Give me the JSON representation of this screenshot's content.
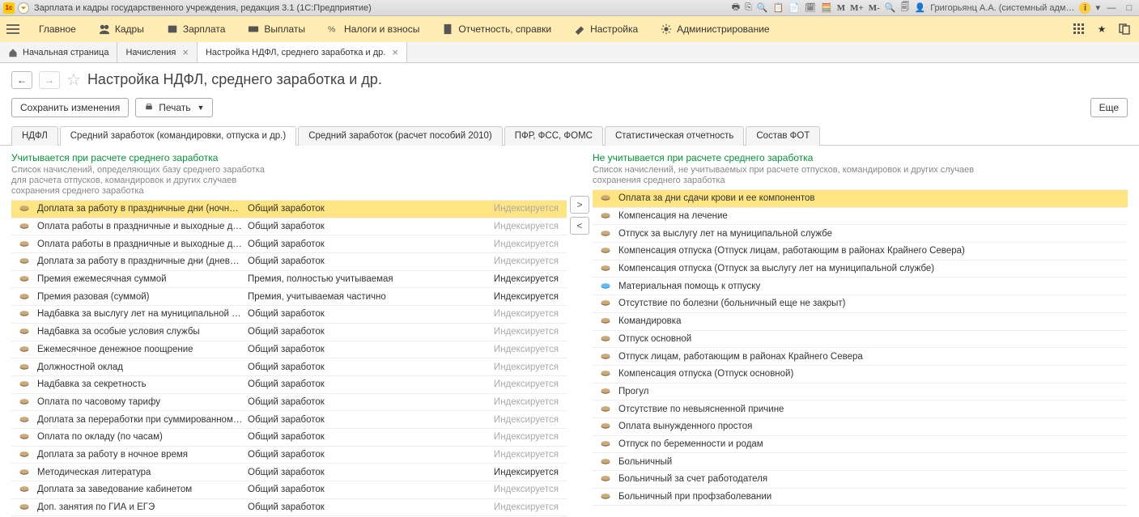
{
  "title": "Зарплата и кадры государственного учреждения, редакция 3.1  (1С:Предприятие)",
  "user": "Григорьянц А.А. (системный адм…",
  "mainmenu": [
    {
      "label": "Главное"
    },
    {
      "label": "Кадры"
    },
    {
      "label": "Зарплата"
    },
    {
      "label": "Выплаты"
    },
    {
      "label": "Налоги и взносы"
    },
    {
      "label": "Отчетность, справки"
    },
    {
      "label": "Настройка"
    },
    {
      "label": "Администрирование"
    }
  ],
  "tabs": {
    "home": "Начальная страница",
    "t1": "Начисления",
    "t2": "Настройка НДФЛ, среднего заработка и др."
  },
  "page_title": "Настройка НДФЛ, среднего заработка и др.",
  "buttons": {
    "save": "Сохранить изменения",
    "print": "Печать",
    "more": "Еще"
  },
  "inner_tabs": [
    "НДФЛ",
    "Средний заработок (командировки, отпуска и др.)",
    "Средний заработок (расчет пособий 2010)",
    "ПФР, ФСС, ФОМС",
    "Статистическая отчетность",
    "Состав ФОТ"
  ],
  "left": {
    "header": "Учитывается при расчете среднего заработка",
    "desc": "Список начислений, определяющих базу среднего заработка для расчета отпусков, командировок и других случаев сохранения среднего заработка",
    "index_label": "Индексируется",
    "rows": [
      {
        "name": "Доплата за работу в праздничные дни (ночное вр…",
        "cat": "Общий заработок",
        "idx": "gray",
        "sel": true
      },
      {
        "name": "Оплата работы в праздничные и выходные дни бе…",
        "cat": "Общий заработок",
        "idx": "gray"
      },
      {
        "name": "Оплата работы в праздничные и выходные дни",
        "cat": "Общий заработок",
        "idx": "gray"
      },
      {
        "name": "Доплата за работу в праздничные дни (дневное в…",
        "cat": "Общий заработок",
        "idx": "gray"
      },
      {
        "name": "Премия ежемесячная суммой",
        "cat": "Премия, полностью учитываемая",
        "idx": "black"
      },
      {
        "name": "Премия разовая (суммой)",
        "cat": "Премия, учитываемая частично",
        "idx": "black"
      },
      {
        "name": "Надбавка за выслугу лет на муниципальной службе",
        "cat": "Общий заработок",
        "idx": "gray"
      },
      {
        "name": "Надбавка за особые условия службы",
        "cat": "Общий заработок",
        "idx": "gray"
      },
      {
        "name": "Ежемесячное денежное поощрение",
        "cat": "Общий заработок",
        "idx": "gray"
      },
      {
        "name": "Должностной оклад",
        "cat": "Общий заработок",
        "idx": "gray"
      },
      {
        "name": "Надбавка за секретность",
        "cat": "Общий заработок",
        "idx": "gray"
      },
      {
        "name": "Оплата по часовому тарифу",
        "cat": "Общий заработок",
        "idx": "gray"
      },
      {
        "name": "Доплата за переработки при суммированном учет…",
        "cat": "Общий заработок",
        "idx": "gray"
      },
      {
        "name": "Оплата по окладу (по часам)",
        "cat": "Общий заработок",
        "idx": "gray"
      },
      {
        "name": "Доплата за работу в ночное время",
        "cat": "Общий заработок",
        "idx": "gray"
      },
      {
        "name": "Методическая литература",
        "cat": "Общий заработок",
        "idx": "black"
      },
      {
        "name": "Доплата за заведование кабинетом",
        "cat": "Общий заработок",
        "idx": "gray"
      },
      {
        "name": "Доп. занятия по ГИА и ЕГЭ",
        "cat": "Общий заработок",
        "idx": "gray"
      }
    ]
  },
  "right": {
    "header": "Не учитывается при расчете среднего заработка",
    "desc": "Список начислений, не учитываемых при расчете отпусков, командировок и других случаев сохранения среднего заработка",
    "rows": [
      {
        "name": "Оплата за дни сдачи крови и ее компонентов",
        "sel": true
      },
      {
        "name": "Компенсация на лечение"
      },
      {
        "name": "Отпуск за выслугу лет на муниципальной службе"
      },
      {
        "name": "Компенсация отпуска (Отпуск лицам, работающим в районах Крайнего Севера)"
      },
      {
        "name": "Компенсация отпуска (Отпуск за выслугу лет на муниципальной службе)"
      },
      {
        "name": "Материальная помощь к отпуску",
        "blue": true
      },
      {
        "name": "Отсутствие по болезни (больничный еще не закрыт)"
      },
      {
        "name": "Командировка"
      },
      {
        "name": "Отпуск основной"
      },
      {
        "name": "Отпуск лицам, работающим в районах Крайнего Севера"
      },
      {
        "name": "Компенсация отпуска (Отпуск основной)"
      },
      {
        "name": "Прогул"
      },
      {
        "name": "Отсутствие по невыясненной причине"
      },
      {
        "name": "Оплата вынужденного простоя"
      },
      {
        "name": "Отпуск по беременности и родам"
      },
      {
        "name": "Больничный"
      },
      {
        "name": "Больничный за счет работодателя"
      },
      {
        "name": "Больничный при профзаболевании"
      }
    ]
  }
}
